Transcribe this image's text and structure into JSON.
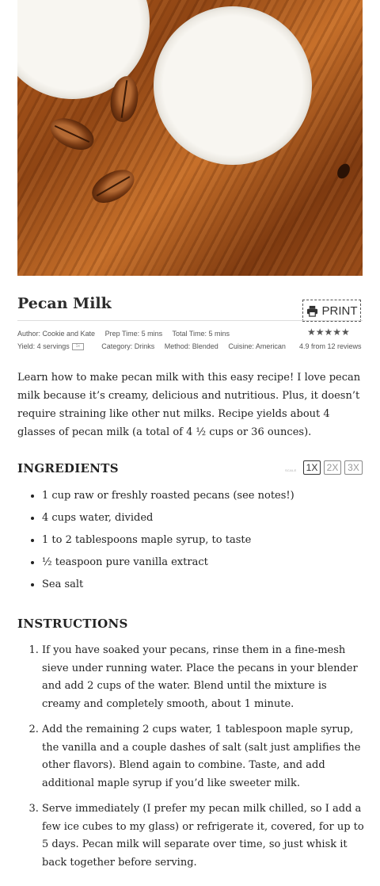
{
  "recipe": {
    "title": "Pecan Milk",
    "print_label": "PRINT",
    "author": "Author: Cookie and Kate",
    "prep_time": "Prep Time: 5 mins",
    "total_time": "Total Time: 5 mins",
    "yield": "Yield: 4 servings",
    "servings_box": "1x",
    "category": "Category: Drinks",
    "method": "Method: Blended",
    "cuisine": "Cuisine: American",
    "stars": "★★★★★",
    "rating_value": 4.9,
    "reviews": "4.9 from 12 reviews",
    "summary": "Learn how to make pecan milk with this easy recipe! I love pecan milk because it’s creamy, delicious and nutritious. Plus, it doesn’t require straining like other nut milks. Recipe yields about 4 glasses of pecan milk (a total of 4 ½ cups or 36 ounces)."
  },
  "ingredients": {
    "heading": "INGREDIENTS",
    "scale_label": "SCALE",
    "scale_options": [
      "1X",
      "2X",
      "3X"
    ],
    "selected_scale": "1X",
    "items": [
      "1 cup raw or freshly roasted pecans (see notes!)",
      "4 cups water, divided",
      "1 to 2 tablespoons maple syrup, to taste",
      "½ teaspoon pure vanilla extract",
      "Sea salt"
    ]
  },
  "instructions": {
    "heading": "INSTRUCTIONS",
    "steps": [
      "If you have soaked your pecans, rinse them in a fine-mesh sieve under running water. Place the pecans in your blender and add 2 cups of the water. Blend until the mixture is creamy and completely smooth, about 1 minute.",
      "Add the remaining 2 cups water, 1 tablespoon maple syrup, the vanilla and a couple dashes of salt (salt just amplifies the other flavors). Blend again to combine. Taste, and add additional maple syrup if you’d like sweeter milk.",
      "Serve immediately (I prefer my pecan milk chilled, so I add a few ice cubes to my glass) or refrigerate it, covered, for up to 5 days. Pecan milk will separate over time, so just whisk it back together before serving."
    ]
  }
}
